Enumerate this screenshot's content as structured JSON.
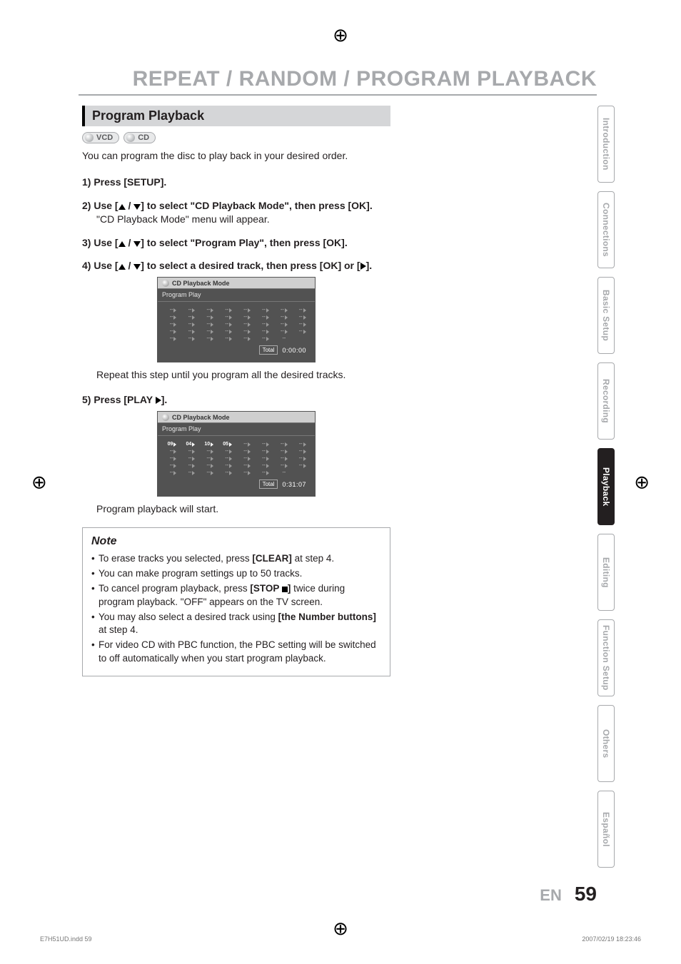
{
  "header": {
    "title": "REPEAT / RANDOM / PROGRAM PLAYBACK"
  },
  "section": {
    "heading": "Program Playback"
  },
  "badges": {
    "vcd": "VCD",
    "cd": "CD"
  },
  "intro": "You can program the disc to play back in your desired order.",
  "steps": {
    "s1": "1) Press [SETUP].",
    "s2_a": "2) Use [",
    "s2_b": " / ",
    "s2_c": "] to select \"CD Playback Mode\", then press [OK].",
    "s2_sub": "\"CD Playback Mode\" menu will appear.",
    "s3_a": "3) Use [",
    "s3_b": " / ",
    "s3_c": "] to select \"Program Play\", then press [OK].",
    "s4_a": "4) Use [",
    "s4_b": " / ",
    "s4_c": "] to select a desired track, then press [OK] or [",
    "s4_d": "].",
    "after4": "Repeat this step until you program all the desired tracks.",
    "s5_a": "5) Press [PLAY ",
    "s5_b": "].",
    "after5": "Program playback will start."
  },
  "osd": {
    "title": "CD Playback Mode",
    "subtitle": "Program Play",
    "total_label": "Total",
    "time_empty": "0:00:00",
    "time_filled": "0:31:07",
    "filled_cells": [
      "09",
      "04",
      "10",
      "05"
    ]
  },
  "note": {
    "heading": "Note",
    "items": {
      "n1_a": "To erase tracks you selected, press ",
      "n1_b": "[CLEAR]",
      "n1_c": " at step 4.",
      "n2": "You can make program settings up to 50 tracks.",
      "n3_a": "To cancel program playback, press ",
      "n3_b": "[STOP ",
      "n3_c": "]",
      "n3_d": " twice during program playback. \"OFF\" appears on the TV screen.",
      "n4_a": "You may also select a desired track using ",
      "n4_b": "[the Number buttons]",
      "n4_c": " at step 4.",
      "n5": "For video CD with PBC function, the PBC setting will be switched to off automatically when you start program playback."
    }
  },
  "tabs": {
    "t1": "Introduction",
    "t2": "Connections",
    "t3": "Basic Setup",
    "t4": "Recording",
    "t5": "Playback",
    "t6": "Editing",
    "t7": "Function Setup",
    "t8": "Others",
    "t9": "Español"
  },
  "footer": {
    "lang": "EN",
    "page": "59"
  },
  "slug": {
    "left": "E7H51UD.indd   59",
    "right": "2007/02/19   18:23:46"
  }
}
